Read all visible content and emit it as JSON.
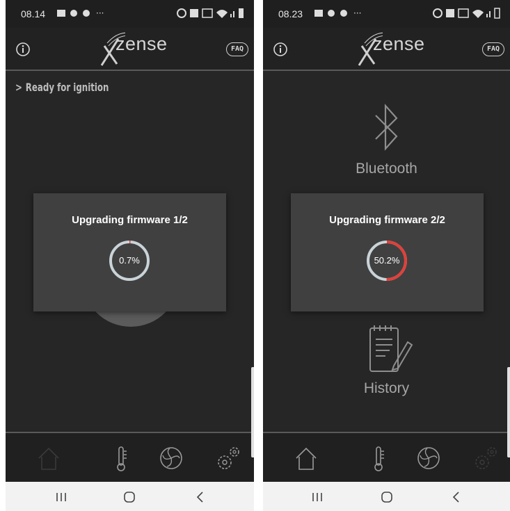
{
  "screens": [
    {
      "status_time": "08.14",
      "logo_text": "zense",
      "faq_label": "FAQ",
      "ready_label": "Ready for ignition",
      "dialog": {
        "title": "Upgrading firmware 1/2",
        "progress_text": "0.7%",
        "progress": 0.007
      },
      "tabs": [
        "home-icon",
        "thermometer-icon",
        "fan-icon",
        "settings-icon"
      ]
    },
    {
      "status_time": "08.23",
      "logo_text": "zense",
      "faq_label": "FAQ",
      "options": {
        "bluetooth_label": "Bluetooth",
        "history_label": "History"
      },
      "dialog": {
        "title": "Upgrading firmware 2/2",
        "progress_text": "50.2%",
        "progress": 0.502
      },
      "tabs": [
        "home-icon",
        "thermometer-icon",
        "fan-icon",
        "settings-icon"
      ]
    }
  ],
  "colors": {
    "background": "#262626",
    "dialog": "#404040",
    "progress_track": "#c9d3d8",
    "progress_fill": "#e0403a",
    "navbar": "#f2f2f2"
  },
  "system_nav": [
    "recents-icon",
    "home-nav-icon",
    "back-icon"
  ]
}
